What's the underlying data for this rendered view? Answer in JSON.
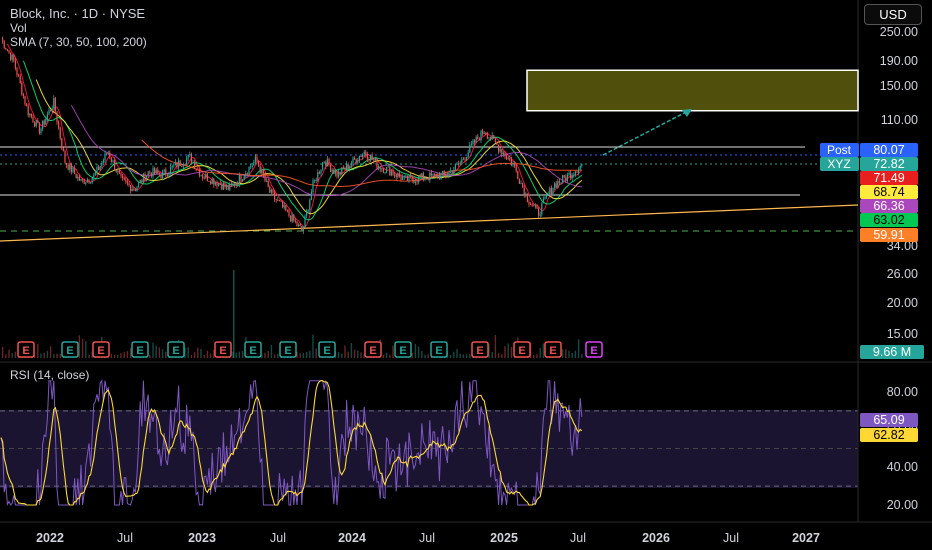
{
  "header": {
    "symbol_line": "Block, Inc. · 1D · NYSE",
    "vol_label": "Vol",
    "sma_label": "SMA (7, 30, 50, 100, 200)",
    "currency": "USD"
  },
  "price_axis": {
    "ticks": [
      "250.00",
      "190.00",
      "150.00",
      "110.00",
      "34.00",
      "26.00",
      "20.00",
      "15.00"
    ],
    "scale": "log"
  },
  "rsi_axis": {
    "ticks": [
      "80.00",
      "60.00",
      "40.00",
      "20.00"
    ]
  },
  "time_axis": {
    "ticks": [
      "2022",
      "Jul",
      "2023",
      "Jul",
      "2024",
      "Jul",
      "2025",
      "Jul",
      "2026",
      "Jul",
      "2027"
    ]
  },
  "price_labels": [
    {
      "text": "Post",
      "value": "80.07",
      "color": "#2962ff"
    },
    {
      "text": "XYZ",
      "value": "72.82",
      "color": "#26a69a"
    },
    {
      "text": "",
      "value": "71.49",
      "color": "#e91e1e"
    },
    {
      "text": "",
      "value": "68.74",
      "color": "#ffeb3b"
    },
    {
      "text": "",
      "value": "66.36",
      "color": "#ab47bc"
    },
    {
      "text": "",
      "value": "63.02",
      "color": "#00c853"
    },
    {
      "text": "",
      "value": "59.91",
      "color": "#ff7f27"
    }
  ],
  "volume_label": "9.66 M",
  "rsi": {
    "label": "RSI (14, close)",
    "value": "65.09",
    "ma_value": "62.82",
    "upper": 70,
    "middle": 50,
    "lower": 30
  },
  "earnings_markers": [
    "E",
    "E",
    "E",
    "E",
    "E",
    "E",
    "E",
    "E",
    "E",
    "E",
    "E",
    "E",
    "E",
    "E",
    "E",
    "E"
  ],
  "colors": {
    "up": "#26a69a",
    "down": "#ef5350",
    "sma7": "#ff1744",
    "sma30": "#00e676",
    "sma50": "#ffeb3b",
    "sma100": "#ab47bc",
    "sma200": "#ff5722",
    "rsi_line": "#7e57c2",
    "rsi_ma": "#fdd835",
    "target_box": "#6b6b10",
    "trendline": "#ffb74d"
  },
  "chart_data": {
    "type": "candlestick",
    "title": "Block, Inc. · 1D · NYSE",
    "y_scale": "log",
    "price_path": [
      [
        "2021-12-15",
        240
      ],
      [
        "2022-01-15",
        190
      ],
      [
        "2022-02-15",
        120
      ],
      [
        "2022-03-15",
        100
      ],
      [
        "2022-04-15",
        130
      ],
      [
        "2022-05-10",
        75
      ],
      [
        "2022-06-15",
        62
      ],
      [
        "2022-07-15",
        65
      ],
      [
        "2022-08-15",
        82
      ],
      [
        "2022-09-15",
        62
      ],
      [
        "2022-10-15",
        58
      ],
      [
        "2022-11-15",
        68
      ],
      [
        "2022-12-15",
        66
      ],
      [
        "2023-01-15",
        72
      ],
      [
        "2023-02-15",
        78
      ],
      [
        "2023-03-15",
        66
      ],
      [
        "2023-04-15",
        62
      ],
      [
        "2023-05-15",
        58
      ],
      [
        "2023-06-15",
        66
      ],
      [
        "2023-07-15",
        76
      ],
      [
        "2023-08-15",
        56
      ],
      [
        "2023-09-15",
        48
      ],
      [
        "2023-10-27",
        39
      ],
      [
        "2023-11-20",
        60
      ],
      [
        "2023-12-15",
        76
      ],
      [
        "2024-01-15",
        66
      ],
      [
        "2024-02-15",
        74
      ],
      [
        "2024-03-15",
        82
      ],
      [
        "2024-04-15",
        72
      ],
      [
        "2024-05-15",
        68
      ],
      [
        "2024-06-15",
        63
      ],
      [
        "2024-07-15",
        64
      ],
      [
        "2024-08-15",
        65
      ],
      [
        "2024-09-15",
        66
      ],
      [
        "2024-10-15",
        73
      ],
      [
        "2024-11-15",
        88
      ],
      [
        "2024-12-10",
        100
      ],
      [
        "2025-01-15",
        84
      ],
      [
        "2025-02-15",
        72
      ],
      [
        "2025-03-15",
        54
      ],
      [
        "2025-04-10",
        46
      ],
      [
        "2025-05-15",
        60
      ],
      [
        "2025-06-15",
        65
      ],
      [
        "2025-07-18",
        72.82
      ]
    ],
    "horizontal_levels": [
      80.07,
      59.91,
      34.0
    ],
    "target_zone": {
      "low": 120,
      "high": 175,
      "from": "2025-07",
      "to": "2027-03"
    },
    "legend": [
      "SMA 7",
      "SMA 30",
      "SMA 50",
      "SMA 100",
      "SMA 200"
    ],
    "xlabel": "",
    "ylabel": ""
  }
}
